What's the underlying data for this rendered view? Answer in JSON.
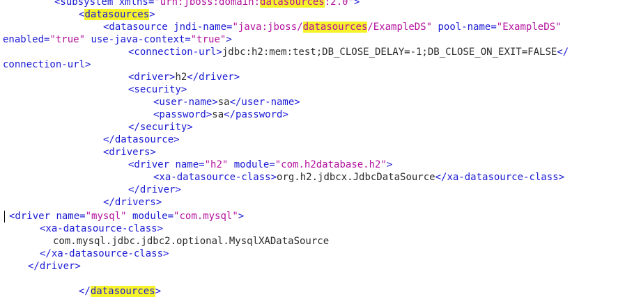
{
  "editor": {
    "lines": [
      [
        {
          "t": "<subsystem ",
          "c": "tag"
        },
        {
          "t": "xmlns=",
          "c": "attr"
        },
        {
          "t": "\"urn:jboss:domain:",
          "c": "val"
        },
        {
          "t": "datasources",
          "c": "val",
          "hl": true
        },
        {
          "t": ":2.0\"",
          "c": "val"
        },
        {
          "t": ">",
          "c": "tag"
        }
      ],
      [
        {
          "t": "<",
          "c": "tag"
        },
        {
          "t": "datasources",
          "c": "tag",
          "hl": true
        },
        {
          "t": ">",
          "c": "tag"
        }
      ],
      [
        {
          "t": "<datasource ",
          "c": "tag"
        },
        {
          "t": "jndi-name=",
          "c": "attr"
        },
        {
          "t": "\"java:jboss/",
          "c": "val"
        },
        {
          "t": "datasources",
          "c": "val",
          "hl": true
        },
        {
          "t": "/ExampleDS\"",
          "c": "val"
        },
        {
          "t": " pool-name=",
          "c": "attr"
        },
        {
          "t": "\"ExampleDS\"",
          "c": "val"
        }
      ],
      [
        {
          "t": "enabled=",
          "c": "attr"
        },
        {
          "t": "\"true\"",
          "c": "val"
        },
        {
          "t": " use-java-context=",
          "c": "attr"
        },
        {
          "t": "\"true\"",
          "c": "val"
        },
        {
          "t": ">",
          "c": "tag"
        }
      ],
      [
        {
          "t": "<connection-url>",
          "c": "tag"
        },
        {
          "t": "jdbc:h2:mem:test;DB_CLOSE_DELAY=-1;DB_CLOSE_ON_EXIT=FALSE",
          "c": "txt"
        },
        {
          "t": "</",
          "c": "tag"
        }
      ],
      [
        {
          "t": "connection-url>",
          "c": "tag"
        }
      ],
      [
        {
          "t": "<driver>",
          "c": "tag"
        },
        {
          "t": "h2",
          "c": "txt"
        },
        {
          "t": "</driver>",
          "c": "tag"
        }
      ],
      [
        {
          "t": "<security>",
          "c": "tag"
        }
      ],
      [
        {
          "t": "<user-name>",
          "c": "tag"
        },
        {
          "t": "sa",
          "c": "txt"
        },
        {
          "t": "</user-name>",
          "c": "tag"
        }
      ],
      [
        {
          "t": "<password>",
          "c": "tag"
        },
        {
          "t": "sa",
          "c": "txt"
        },
        {
          "t": "</password>",
          "c": "tag"
        }
      ],
      [
        {
          "t": "</security>",
          "c": "tag"
        }
      ],
      [
        {
          "t": "</datasource>",
          "c": "tag"
        }
      ],
      [
        {
          "t": "<drivers>",
          "c": "tag"
        }
      ],
      [
        {
          "t": "<driver ",
          "c": "tag"
        },
        {
          "t": "name=",
          "c": "attr"
        },
        {
          "t": "\"h2\"",
          "c": "val"
        },
        {
          "t": " module=",
          "c": "attr"
        },
        {
          "t": "\"com.h2database.h2\"",
          "c": "val"
        },
        {
          "t": ">",
          "c": "tag"
        }
      ],
      [
        {
          "t": "<xa-datasource-class>",
          "c": "tag"
        },
        {
          "t": "org.h2.jdbcx.JdbcDataSource",
          "c": "txt"
        },
        {
          "t": "</xa-datasource-class>",
          "c": "tag"
        }
      ],
      [
        {
          "t": "</driver>",
          "c": "tag"
        }
      ],
      [
        {
          "t": "</drivers>",
          "c": "tag"
        }
      ],
      [
        {
          "t": "<driver ",
          "c": "tag"
        },
        {
          "t": "name=",
          "c": "attr"
        },
        {
          "t": "\"mysql\"",
          "c": "val"
        },
        {
          "t": " module=",
          "c": "attr"
        },
        {
          "t": "\"com.mysql\"",
          "c": "val"
        },
        {
          "t": ">",
          "c": "tag"
        }
      ],
      [
        {
          "t": "<xa-datasource-class>",
          "c": "tag"
        }
      ],
      [
        {
          "t": "com.mysql.jdbc.jdbc2.optional.MysqlXADataSource",
          "c": "txt"
        }
      ],
      [
        {
          "t": "</xa-datasource-class>",
          "c": "tag"
        }
      ],
      [
        {
          "t": "</driver>",
          "c": "tag"
        }
      ],
      [],
      [
        {
          "t": "</",
          "c": "tag"
        },
        {
          "t": "datasources",
          "c": "tag",
          "hl": true
        },
        {
          "t": ">",
          "c": "tag"
        }
      ]
    ]
  }
}
